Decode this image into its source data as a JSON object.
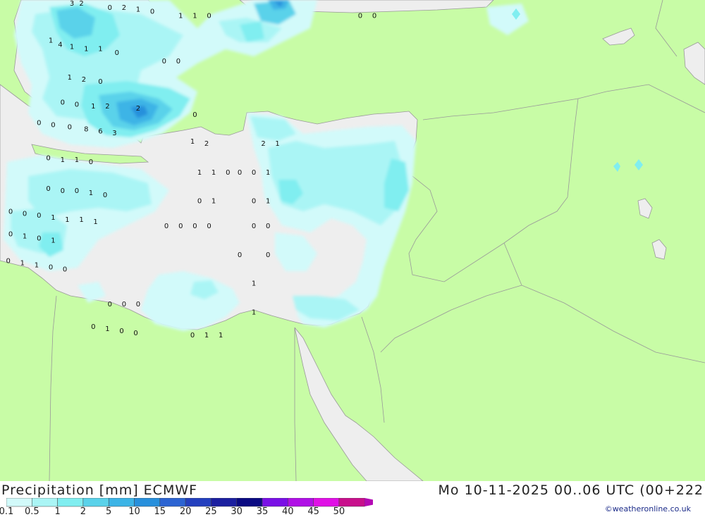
{
  "map": {
    "value_labels": [
      {
        "text": "3",
        "lon": 26.4,
        "lat": 39.4
      },
      {
        "text": "2",
        "lon": 26.8,
        "lat": 39.4
      },
      {
        "text": "0",
        "lon": 28.0,
        "lat": 39.3
      },
      {
        "text": "2",
        "lon": 28.6,
        "lat": 39.3
      },
      {
        "text": "1",
        "lon": 29.2,
        "lat": 39.25
      },
      {
        "text": "0",
        "lon": 29.8,
        "lat": 39.2
      },
      {
        "text": "1",
        "lon": 31.0,
        "lat": 39.1
      },
      {
        "text": "1",
        "lon": 31.6,
        "lat": 39.1
      },
      {
        "text": "0",
        "lon": 32.2,
        "lat": 39.1
      },
      {
        "text": "0",
        "lon": 38.6,
        "lat": 39.1
      },
      {
        "text": "0",
        "lon": 39.2,
        "lat": 39.1
      },
      {
        "text": "1",
        "lon": 25.5,
        "lat": 38.5
      },
      {
        "text": "4",
        "lon": 25.9,
        "lat": 38.4
      },
      {
        "text": "1",
        "lon": 26.4,
        "lat": 38.35
      },
      {
        "text": "1",
        "lon": 27.0,
        "lat": 38.3
      },
      {
        "text": "1",
        "lon": 27.6,
        "lat": 38.3
      },
      {
        "text": "0",
        "lon": 28.3,
        "lat": 38.2
      },
      {
        "text": "0",
        "lon": 30.3,
        "lat": 38.0
      },
      {
        "text": "0",
        "lon": 30.9,
        "lat": 38.0
      },
      {
        "text": "1",
        "lon": 26.3,
        "lat": 37.6
      },
      {
        "text": "2",
        "lon": 26.9,
        "lat": 37.55
      },
      {
        "text": "0",
        "lon": 27.6,
        "lat": 37.5
      },
      {
        "text": "0",
        "lon": 26.0,
        "lat": 37.0
      },
      {
        "text": "0",
        "lon": 26.6,
        "lat": 36.95
      },
      {
        "text": "1",
        "lon": 27.3,
        "lat": 36.9
      },
      {
        "text": "2",
        "lon": 27.9,
        "lat": 36.9
      },
      {
        "text": "2",
        "lon": 29.2,
        "lat": 36.85
      },
      {
        "text": "0",
        "lon": 31.6,
        "lat": 36.7
      },
      {
        "text": "0",
        "lon": 25.0,
        "lat": 36.5
      },
      {
        "text": "0",
        "lon": 25.6,
        "lat": 36.45
      },
      {
        "text": "0",
        "lon": 26.3,
        "lat": 36.4
      },
      {
        "text": "8",
        "lon": 27.0,
        "lat": 36.35
      },
      {
        "text": "6",
        "lon": 27.6,
        "lat": 36.3
      },
      {
        "text": "3",
        "lon": 28.2,
        "lat": 36.25
      },
      {
        "text": "1",
        "lon": 31.5,
        "lat": 36.05
      },
      {
        "text": "2",
        "lon": 32.1,
        "lat": 36.0
      },
      {
        "text": "2",
        "lon": 34.5,
        "lat": 36.0
      },
      {
        "text": "1",
        "lon": 35.1,
        "lat": 36.0
      },
      {
        "text": "0",
        "lon": 25.4,
        "lat": 35.65
      },
      {
        "text": "1",
        "lon": 26.0,
        "lat": 35.6
      },
      {
        "text": "1",
        "lon": 26.6,
        "lat": 35.6
      },
      {
        "text": "0",
        "lon": 27.2,
        "lat": 35.55
      },
      {
        "text": "1",
        "lon": 31.8,
        "lat": 35.3
      },
      {
        "text": "1",
        "lon": 32.4,
        "lat": 35.3
      },
      {
        "text": "0",
        "lon": 33.0,
        "lat": 35.3
      },
      {
        "text": "0",
        "lon": 33.5,
        "lat": 35.3
      },
      {
        "text": "0",
        "lon": 34.1,
        "lat": 35.3
      },
      {
        "text": "1",
        "lon": 34.7,
        "lat": 35.3
      },
      {
        "text": "0",
        "lon": 25.4,
        "lat": 34.9
      },
      {
        "text": "0",
        "lon": 26.0,
        "lat": 34.85
      },
      {
        "text": "0",
        "lon": 26.6,
        "lat": 34.85
      },
      {
        "text": "1",
        "lon": 27.2,
        "lat": 34.8
      },
      {
        "text": "0",
        "lon": 27.8,
        "lat": 34.75
      },
      {
        "text": "0",
        "lon": 31.8,
        "lat": 34.6
      },
      {
        "text": "1",
        "lon": 32.4,
        "lat": 34.6
      },
      {
        "text": "0",
        "lon": 34.1,
        "lat": 34.6
      },
      {
        "text": "1",
        "lon": 34.7,
        "lat": 34.6
      },
      {
        "text": "0",
        "lon": 23.8,
        "lat": 34.35
      },
      {
        "text": "0",
        "lon": 24.4,
        "lat": 34.3
      },
      {
        "text": "0",
        "lon": 25.0,
        "lat": 34.25
      },
      {
        "text": "1",
        "lon": 25.6,
        "lat": 34.2
      },
      {
        "text": "1",
        "lon": 26.2,
        "lat": 34.15
      },
      {
        "text": "1",
        "lon": 26.8,
        "lat": 34.15
      },
      {
        "text": "1",
        "lon": 27.4,
        "lat": 34.1
      },
      {
        "text": "0",
        "lon": 30.4,
        "lat": 34.0
      },
      {
        "text": "0",
        "lon": 31.0,
        "lat": 34.0
      },
      {
        "text": "0",
        "lon": 31.6,
        "lat": 34.0
      },
      {
        "text": "0",
        "lon": 32.2,
        "lat": 34.0
      },
      {
        "text": "0",
        "lon": 34.1,
        "lat": 34.0
      },
      {
        "text": "0",
        "lon": 34.7,
        "lat": 34.0
      },
      {
        "text": "0",
        "lon": 23.8,
        "lat": 33.8
      },
      {
        "text": "1",
        "lon": 24.4,
        "lat": 33.75
      },
      {
        "text": "0",
        "lon": 25.0,
        "lat": 33.7
      },
      {
        "text": "1",
        "lon": 25.6,
        "lat": 33.65
      },
      {
        "text": "0",
        "lon": 33.5,
        "lat": 33.3
      },
      {
        "text": "0",
        "lon": 34.7,
        "lat": 33.3
      },
      {
        "text": "0",
        "lon": 23.7,
        "lat": 33.15
      },
      {
        "text": "1",
        "lon": 24.3,
        "lat": 33.1
      },
      {
        "text": "1",
        "lon": 24.9,
        "lat": 33.05
      },
      {
        "text": "0",
        "lon": 25.5,
        "lat": 33.0
      },
      {
        "text": "0",
        "lon": 26.1,
        "lat": 32.95
      },
      {
        "text": "1",
        "lon": 34.1,
        "lat": 32.6
      },
      {
        "text": "0",
        "lon": 28.0,
        "lat": 32.1
      },
      {
        "text": "0",
        "lon": 28.6,
        "lat": 32.1
      },
      {
        "text": "0",
        "lon": 29.2,
        "lat": 32.1
      },
      {
        "text": "1",
        "lon": 34.1,
        "lat": 31.9
      },
      {
        "text": "0",
        "lon": 27.3,
        "lat": 31.55
      },
      {
        "text": "1",
        "lon": 27.9,
        "lat": 31.5
      },
      {
        "text": "0",
        "lon": 28.5,
        "lat": 31.45
      },
      {
        "text": "0",
        "lon": 29.1,
        "lat": 31.4
      },
      {
        "text": "0",
        "lon": 31.5,
        "lat": 31.35
      },
      {
        "text": "1",
        "lon": 32.1,
        "lat": 31.35
      },
      {
        "text": "1",
        "lon": 32.7,
        "lat": 31.35
      }
    ]
  },
  "footer": {
    "title": "Precipitation [mm] ECMWF",
    "datetime": "Mo 10-11-2025 00..06 UTC (00+222",
    "credit": "©weatheronline.co.uk",
    "legend": {
      "labels": [
        "0.1",
        "0.5",
        "1",
        "2",
        "5",
        "10",
        "15",
        "20",
        "25",
        "30",
        "35",
        "40",
        "45",
        "50"
      ],
      "colors": [
        "#d2fafa",
        "#aaf5f5",
        "#80eef0",
        "#5ad2ea",
        "#3cb4e6",
        "#2890dc",
        "#2c64d2",
        "#2440be",
        "#1c20a0",
        "#0a0a82",
        "#7a10e6",
        "#b010e6",
        "#e010e6",
        "#c8108c",
        "#b40ab4"
      ]
    }
  }
}
